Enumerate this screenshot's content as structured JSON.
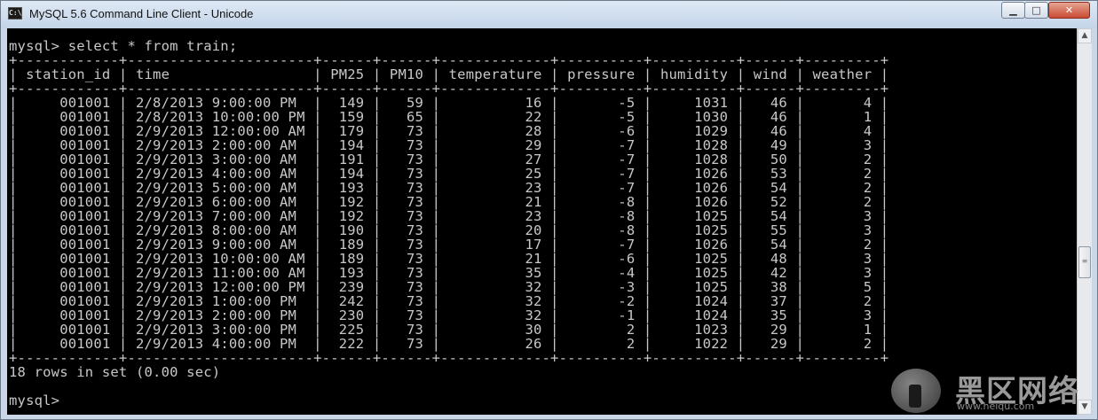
{
  "window": {
    "title": "MySQL 5.6 Command Line Client - Unicode",
    "icon": "mysql-console-icon",
    "controls": {
      "minimize": "▁",
      "maximize": "□",
      "close": "✕"
    }
  },
  "console": {
    "prompt": "mysql>",
    "command": "select * from train;",
    "columns": [
      "station_id",
      "time",
      "PM25",
      "PM10",
      "temperature",
      "pressure",
      "humidity",
      "wind",
      "weather"
    ],
    "rows": [
      [
        "001001",
        "2/8/2013 9:00:00 PM",
        "149",
        "59",
        "16",
        "-5",
        "1031",
        "46",
        "4"
      ],
      [
        "001001",
        "2/8/2013 10:00:00 PM",
        "159",
        "65",
        "22",
        "-5",
        "1030",
        "46",
        "1"
      ],
      [
        "001001",
        "2/9/2013 12:00:00 AM",
        "179",
        "73",
        "28",
        "-6",
        "1029",
        "46",
        "4"
      ],
      [
        "001001",
        "2/9/2013 2:00:00 AM",
        "194",
        "73",
        "29",
        "-7",
        "1028",
        "49",
        "3"
      ],
      [
        "001001",
        "2/9/2013 3:00:00 AM",
        "191",
        "73",
        "27",
        "-7",
        "1028",
        "50",
        "2"
      ],
      [
        "001001",
        "2/9/2013 4:00:00 AM",
        "194",
        "73",
        "25",
        "-7",
        "1026",
        "53",
        "2"
      ],
      [
        "001001",
        "2/9/2013 5:00:00 AM",
        "193",
        "73",
        "23",
        "-7",
        "1026",
        "54",
        "2"
      ],
      [
        "001001",
        "2/9/2013 6:00:00 AM",
        "192",
        "73",
        "21",
        "-8",
        "1026",
        "52",
        "2"
      ],
      [
        "001001",
        "2/9/2013 7:00:00 AM",
        "192",
        "73",
        "23",
        "-8",
        "1025",
        "54",
        "3"
      ],
      [
        "001001",
        "2/9/2013 8:00:00 AM",
        "190",
        "73",
        "20",
        "-8",
        "1025",
        "55",
        "3"
      ],
      [
        "001001",
        "2/9/2013 9:00:00 AM",
        "189",
        "73",
        "17",
        "-7",
        "1026",
        "54",
        "2"
      ],
      [
        "001001",
        "2/9/2013 10:00:00 AM",
        "189",
        "73",
        "21",
        "-6",
        "1025",
        "48",
        "3"
      ],
      [
        "001001",
        "2/9/2013 11:00:00 AM",
        "193",
        "73",
        "35",
        "-4",
        "1025",
        "42",
        "3"
      ],
      [
        "001001",
        "2/9/2013 12:00:00 PM",
        "239",
        "73",
        "32",
        "-3",
        "1025",
        "38",
        "5"
      ],
      [
        "001001",
        "2/9/2013 1:00:00 PM",
        "242",
        "73",
        "32",
        "-2",
        "1024",
        "37",
        "2"
      ],
      [
        "001001",
        "2/9/2013 2:00:00 PM",
        "230",
        "73",
        "32",
        "-1",
        "1024",
        "35",
        "3"
      ],
      [
        "001001",
        "2/9/2013 3:00:00 PM",
        "225",
        "73",
        "30",
        "2",
        "1023",
        "29",
        "1"
      ],
      [
        "001001",
        "2/9/2013 4:00:00 PM",
        "222",
        "73",
        "26",
        "2",
        "1022",
        "29",
        "2"
      ]
    ],
    "result_text": "18 rows in set (0.00 sec)"
  },
  "watermark": {
    "text": "黑区网络",
    "url": "www.heiqu.com"
  }
}
